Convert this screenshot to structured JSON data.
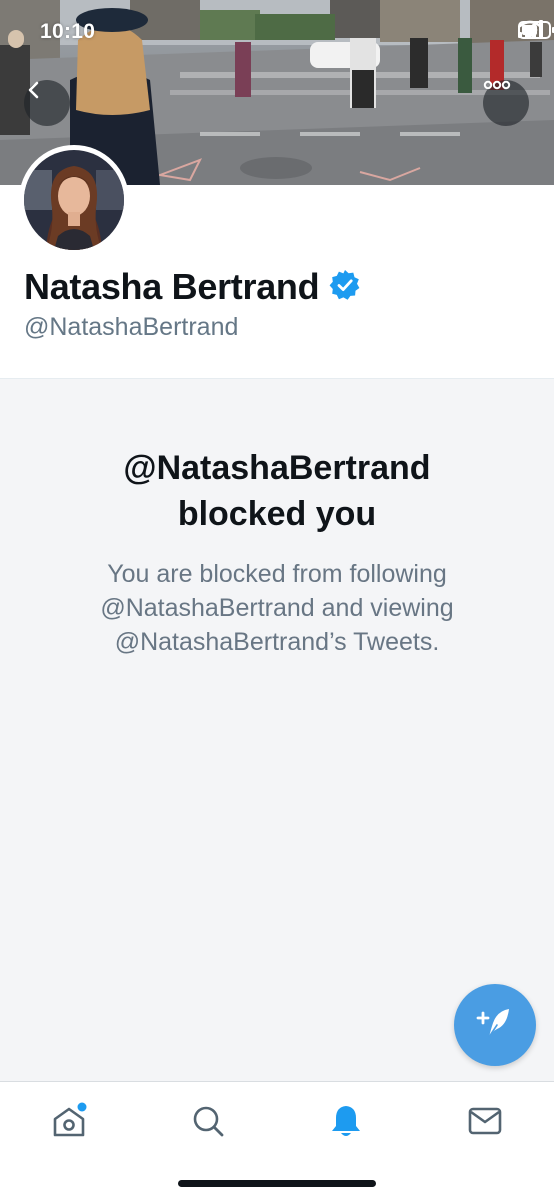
{
  "status_bar": {
    "time": "10:10",
    "icons": [
      "signal-icon",
      "wifi-icon",
      "battery-icon"
    ]
  },
  "header": {
    "back_icon": "chevron-left-icon",
    "more_icon": "more-horizontal-icon"
  },
  "profile": {
    "display_name": "Natasha Bertrand",
    "handle": "@NatashaBertrand",
    "verified": true,
    "verified_icon": "verified-badge-icon"
  },
  "blocked": {
    "title_line1": "@NatashaBertrand",
    "title_line2": "blocked you",
    "message_line1": "You are blocked from following",
    "message_line2": "@NatashaBertrand and viewing",
    "message_line3": "@NatashaBertrand’s Tweets."
  },
  "compose": {
    "icon": "compose-tweet-icon"
  },
  "tab_bar": {
    "items": [
      {
        "name": "home",
        "icon": "home-icon",
        "active": false,
        "has_dot": true
      },
      {
        "name": "search",
        "icon": "search-icon",
        "active": false
      },
      {
        "name": "notifications",
        "icon": "bell-icon",
        "active": true
      },
      {
        "name": "messages",
        "icon": "mail-icon",
        "active": false
      }
    ]
  },
  "colors": {
    "brand": "#1d9bf0",
    "fab": "#4a9de3",
    "text_primary": "#0f1419",
    "text_secondary": "#687684",
    "panel_bg": "#f4f5f7"
  }
}
